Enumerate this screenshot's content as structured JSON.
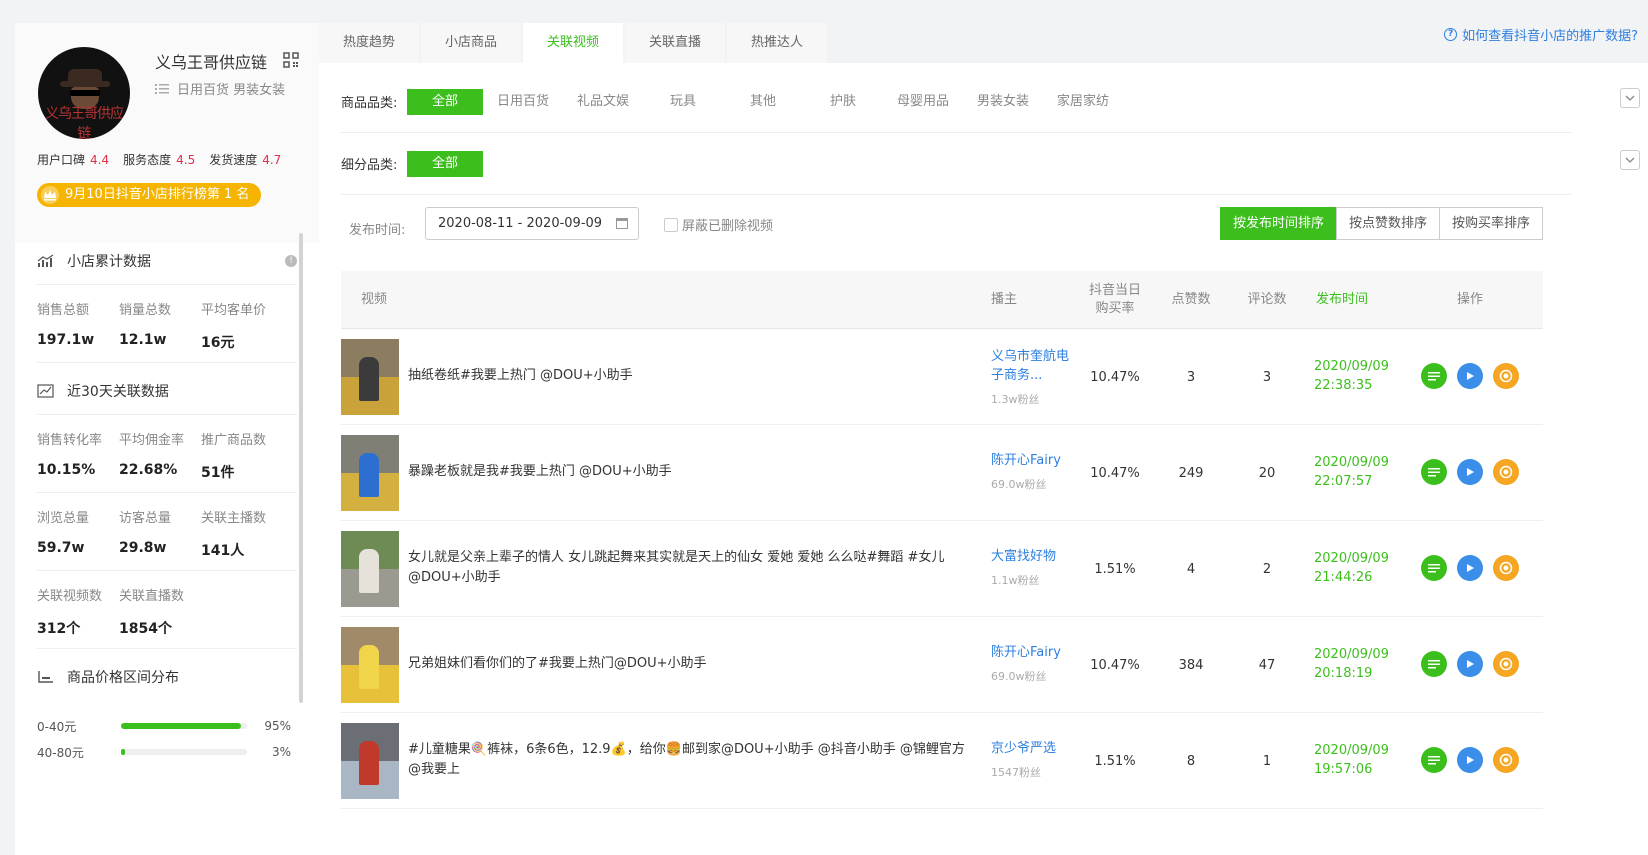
{
  "shop": {
    "name": "义乌王哥供应链",
    "avatar_text": "义乌王哥供应链",
    "categories": "日用百货 男装女装",
    "ratings": [
      {
        "label": "用户口碑",
        "value": "4.4"
      },
      {
        "label": "服务态度",
        "value": "4.5"
      },
      {
        "label": "发货速度",
        "value": "4.7"
      }
    ],
    "rank_badge": "9月10日抖音小店排行榜第 1 名"
  },
  "stats": {
    "cumulative_title": "小店累计数据",
    "cumulative": [
      {
        "label": "销售总额",
        "value": "197.1w"
      },
      {
        "label": "销量总数",
        "value": "12.1w"
      },
      {
        "label": "平均客单价",
        "value": "16元"
      }
    ],
    "recent_title": "近30天关联数据",
    "recent_row1": [
      {
        "label": "销售转化率",
        "value": "10.15%"
      },
      {
        "label": "平均佣金率",
        "value": "22.68%"
      },
      {
        "label": "推广商品数",
        "value": "51件"
      }
    ],
    "recent_row2": [
      {
        "label": "浏览总量",
        "value": "59.7w"
      },
      {
        "label": "访客总量",
        "value": "29.8w"
      },
      {
        "label": "关联主播数",
        "value": "141人"
      }
    ],
    "recent_row3": [
      {
        "label": "关联视频数",
        "value": "312个"
      },
      {
        "label": "关联直播数",
        "value": "1854个"
      }
    ],
    "price_title": "商品价格区间分布",
    "price_dist": [
      {
        "range": "0-40元",
        "pct": "95%",
        "fraction": 0.95
      },
      {
        "range": "40-80元",
        "pct": "3%",
        "fraction": 0.03
      }
    ]
  },
  "tabs": [
    "热度趋势",
    "小店商品",
    "关联视频",
    "关联直播",
    "热推达人"
  ],
  "active_tab": 2,
  "help_link": "如何查看抖音小店的推广数据?",
  "filters": {
    "category_label": "商品品类:",
    "categories": [
      "全部",
      "日用百货",
      "礼品文娱",
      "玩具",
      "其他",
      "护肤",
      "母婴用品",
      "男装女装",
      "家居家纺"
    ],
    "sub_label": "细分品类:",
    "sub_categories": [
      "全部"
    ]
  },
  "time": {
    "label": "发布时间:",
    "range": "2020-08-11 - 2020-09-09",
    "hide_deleted": "屏蔽已删除视频"
  },
  "sort": [
    "按发布时间排序",
    "按点赞数排序",
    "按购买率排序"
  ],
  "table": {
    "headers": {
      "video": "视频",
      "anchor": "播主",
      "buy_rate": "抖音当日\n购买率",
      "likes": "点赞数",
      "comments": "评论数",
      "pub_time": "发布时间",
      "ops": "操作"
    },
    "rows": [
      {
        "title": "抽纸卷纸#我要上热门 @DOU+小助手",
        "anchor": "义乌市奎航电子商务...",
        "fans": "1.3w粉丝",
        "rate": "10.47%",
        "likes": "3",
        "comments": "3",
        "date": "2020/09/09",
        "time": "22:38:35"
      },
      {
        "title": "暴躁老板就是我#我要上热门 @DOU+小助手",
        "anchor": "陈开心Fairy",
        "fans": "69.0w粉丝",
        "rate": "10.47%",
        "likes": "249",
        "comments": "20",
        "date": "2020/09/09",
        "time": "22:07:57"
      },
      {
        "title": "女儿就是父亲上辈子的情人 女儿跳起舞来其实就是天上的仙女 爱她 爱她 么么哒#舞蹈 #女儿 @DOU+小助手",
        "anchor": "大富找好物",
        "fans": "1.1w粉丝",
        "rate": "1.51%",
        "likes": "4",
        "comments": "2",
        "date": "2020/09/09",
        "time": "21:44:26"
      },
      {
        "title": "兄弟姐妹们看你们的了#我要上热门@DOU+小助手",
        "anchor": "陈开心Fairy",
        "fans": "69.0w粉丝",
        "rate": "10.47%",
        "likes": "384",
        "comments": "47",
        "date": "2020/09/09",
        "time": "20:18:19"
      },
      {
        "title": "#儿童糖果🍭裤袜，6条6色，12.9💰，给你🍔邮到家@DOU+小助手 @抖音小助手 @锦鲤官方 @我要上",
        "anchor": "京少爷严选",
        "fans": "1547粉丝",
        "rate": "1.51%",
        "likes": "8",
        "comments": "1",
        "date": "2020/09/09",
        "time": "19:57:06"
      }
    ]
  },
  "colors": {
    "accent": "#3cbf1d",
    "link": "#2d7fe0",
    "rating": "#e0304a",
    "badge": "#f5b400"
  }
}
